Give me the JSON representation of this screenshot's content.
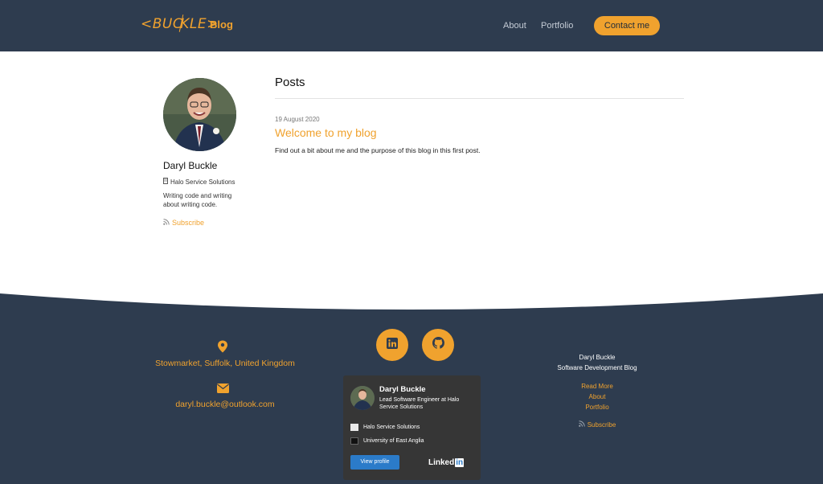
{
  "header": {
    "logo_left": "<BUC",
    "logo_right": "KLE>",
    "brand": "Blog",
    "nav": {
      "about": "About",
      "portfolio": "Portfolio"
    },
    "contact_label": "Contact me",
    "background": "#2e3c4f",
    "accent": "#f0a22e"
  },
  "sidebar": {
    "name": "Daryl Buckle",
    "company": "Halo Service Solutions",
    "bio": "Writing code and writing about writing code.",
    "subscribe": "Subscribe"
  },
  "posts": {
    "heading": "Posts",
    "items": [
      {
        "date": "19 August 2020",
        "title": "Welcome to my blog",
        "excerpt": "Find out a bit about me and the purpose of this blog in this first post."
      }
    ]
  },
  "footer": {
    "location": "Stowmarket, Suffolk, United Kingdom",
    "email": "daryl.buckle@outlook.com",
    "linkedin_card": {
      "name": "Daryl Buckle",
      "role": "Lead Software Engineer at Halo Service Solutions",
      "company": "Halo Service Solutions",
      "education": "University of East Anglia",
      "button": "View profile",
      "brand_text": "Linked",
      "brand_in": "in"
    },
    "right": {
      "name": "Daryl Buckle",
      "subtitle": "Software Development Blog",
      "read_more": "Read More",
      "about": "About",
      "portfolio": "Portfolio",
      "subscribe": "Subscribe"
    }
  }
}
